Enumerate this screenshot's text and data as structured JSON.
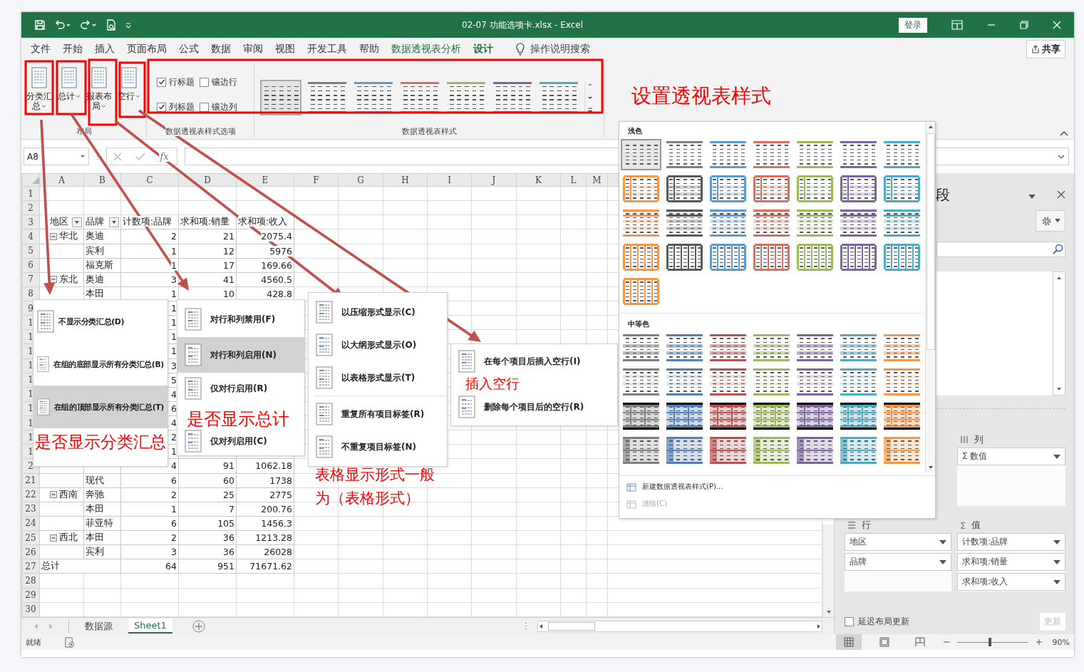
{
  "window": {
    "title": "02-07 功能选项卡.xlsx  -  Excel",
    "sign_in": "登录"
  },
  "ribbon_tabs": [
    {
      "label": "文件",
      "contextual": false,
      "selected": false
    },
    {
      "label": "开始",
      "contextual": false,
      "selected": false
    },
    {
      "label": "插入",
      "contextual": false,
      "selected": false
    },
    {
      "label": "页面布局",
      "contextual": false,
      "selected": false
    },
    {
      "label": "公式",
      "contextual": false,
      "selected": false
    },
    {
      "label": "数据",
      "contextual": false,
      "selected": false
    },
    {
      "label": "审阅",
      "contextual": false,
      "selected": false
    },
    {
      "label": "视图",
      "contextual": false,
      "selected": false
    },
    {
      "label": "开发工具",
      "contextual": false,
      "selected": false
    },
    {
      "label": "帮助",
      "contextual": false,
      "selected": false
    },
    {
      "label": "数据透视表分析",
      "contextual": true,
      "selected": false
    },
    {
      "label": "设计",
      "contextual": true,
      "selected": true
    }
  ],
  "tell_me": "操作说明搜索",
  "share": "共享",
  "ribbon": {
    "layout_group": {
      "label": "布局",
      "buttons": [
        "分类汇总",
        "总计",
        "报表布局",
        "空行"
      ]
    },
    "options_group": {
      "label": "数据透视表样式选项",
      "options": [
        {
          "label": "行标题",
          "checked": true
        },
        {
          "label": "镶边行",
          "checked": false
        },
        {
          "label": "列标题",
          "checked": true
        },
        {
          "label": "镶边列",
          "checked": false
        }
      ]
    },
    "styles_group": {
      "label": "数据透视表样式",
      "styles": [
        {
          "selected": true
        },
        {
          "color": "#7f7f7f",
          "selected": false
        },
        {
          "color": "#5b9bd5",
          "selected": false
        },
        {
          "color": "#e06c5a",
          "selected": false
        },
        {
          "color": "#9bbb59",
          "selected": false
        },
        {
          "color": "#8064a2",
          "selected": false
        },
        {
          "color": "#4bacc6",
          "selected": false
        }
      ]
    }
  },
  "formula_bar": {
    "name_box": "A8",
    "function_label": "fx"
  },
  "sheet": {
    "columns": [
      "A",
      "B",
      "C",
      "D",
      "E",
      "F",
      "G",
      "H",
      "I",
      "J",
      "K",
      "L",
      "M"
    ],
    "rows": [
      {
        "header": "1",
        "kind": "empty"
      },
      {
        "header": "2",
        "kind": "empty"
      },
      {
        "header": "3",
        "kind": "header",
        "region": "地区",
        "brand": "品牌",
        "count": "计数项:品牌",
        "sales": "求和项:销量",
        "revenue": "求和项:收入"
      },
      {
        "header": "4",
        "kind": "item",
        "region": "华北",
        "expanded": true,
        "brand": "奥迪",
        "count": "2",
        "sales": "21",
        "revenue": "2075.4"
      },
      {
        "header": "5",
        "kind": "item",
        "brand": "宾利",
        "count": "1",
        "sales": "12",
        "revenue": "5976"
      },
      {
        "header": "6",
        "kind": "item",
        "brand": "福克斯",
        "count": "1",
        "sales": "17",
        "revenue": "169.66"
      },
      {
        "header": "7",
        "kind": "item",
        "region": "东北",
        "expanded": true,
        "brand": "奥迪",
        "count": "3",
        "sales": "41",
        "revenue": "4560.5"
      },
      {
        "header": "8",
        "kind": "item",
        "brand": "本田",
        "count": "1",
        "sales": "10",
        "revenue": "428.8"
      },
      {
        "header": "9",
        "kind": "item",
        "count": "1"
      },
      {
        "header": "1",
        "kind": "item",
        "count": "1"
      },
      {
        "header": "1",
        "kind": "item",
        "count": "1"
      },
      {
        "header": "1",
        "kind": "item",
        "count": "1"
      },
      {
        "header": "1",
        "kind": "item",
        "count": "3"
      },
      {
        "header": "1",
        "kind": "item",
        "count": "5"
      },
      {
        "header": "1",
        "kind": "item",
        "count": "4"
      },
      {
        "header": "1",
        "kind": "item",
        "count": "6"
      },
      {
        "header": "1",
        "kind": "item",
        "count": "4"
      },
      {
        "header": "1",
        "kind": "item",
        "count": "2"
      },
      {
        "header": "1",
        "kind": "item",
        "count": "1"
      },
      {
        "header": "2",
        "kind": "item",
        "count": "4",
        "sales": "91",
        "revenue": "1062.18"
      },
      {
        "header": "21",
        "kind": "item",
        "brand": "现代",
        "count": "6",
        "sales": "60",
        "revenue": "1738"
      },
      {
        "header": "22",
        "kind": "item",
        "region": "西南",
        "expanded": true,
        "brand": "奔驰",
        "count": "2",
        "sales": "25",
        "revenue": "2775"
      },
      {
        "header": "23",
        "kind": "item",
        "brand": "本田",
        "count": "1",
        "sales": "7",
        "revenue": "200.76"
      },
      {
        "header": "24",
        "kind": "item",
        "brand": "菲亚特",
        "count": "6",
        "sales": "105",
        "revenue": "1456.3"
      },
      {
        "header": "25",
        "kind": "item",
        "region": "西北",
        "expanded": true,
        "brand": "本田",
        "count": "2",
        "sales": "36",
        "revenue": "1213.28"
      },
      {
        "header": "26",
        "kind": "item",
        "brand": "宾利",
        "count": "3",
        "sales": "36",
        "revenue": "26028"
      },
      {
        "header": "27",
        "kind": "total",
        "region": "总计",
        "count": "64",
        "sales": "951",
        "revenue": "71671.62"
      },
      {
        "header": "28",
        "kind": "empty"
      },
      {
        "header": "29",
        "kind": "empty"
      },
      {
        "header": "30",
        "kind": "empty"
      }
    ]
  },
  "sheet_tabs": [
    {
      "label": "数据源",
      "selected": false
    },
    {
      "label": "Sheet1",
      "selected": true
    }
  ],
  "field_list": {
    "title": "段",
    "areas": [
      {
        "kind": "columns",
        "label": "列",
        "fields": [
          "Σ 数值"
        ]
      },
      {
        "kind": "rows",
        "label": "行",
        "fields": [
          "地区",
          "品牌"
        ]
      },
      {
        "kind": "values",
        "label": "值",
        "symbol": "Σ",
        "fields": [
          "计数项:品牌",
          "求和项:销量",
          "求和项:收入"
        ]
      }
    ],
    "defer_update": {
      "label": "延迟布局更新",
      "checked": false
    },
    "update_button": {
      "label": "更新",
      "disabled": true
    }
  },
  "status_bar": {
    "mode": "就绪",
    "views": [
      {
        "kind": "normal",
        "selected": true
      },
      {
        "kind": "page-layout",
        "selected": false
      },
      {
        "kind": "page-break",
        "selected": false
      }
    ],
    "zoom": {
      "level": 0.46,
      "reading": "90%"
    }
  },
  "menus": [
    {
      "kind": "subtotals",
      "items": [
        {
          "label": "不显示分类汇总(D)",
          "selected": false
        },
        {
          "label": "在组的底部显示所有分类汇总(B)",
          "selected": false
        },
        {
          "label": "在组的顶部显示所有分类汇总(T)",
          "selected": true
        }
      ]
    },
    {
      "kind": "grand-totals",
      "items": [
        {
          "label": "对行和列禁用(F)",
          "selected": false
        },
        {
          "label": "对行和列启用(N)",
          "selected": true
        },
        {
          "label": "仅对行启用(R)",
          "selected": false
        },
        {
          "label": "仅对列启用(C)",
          "selected": false
        }
      ]
    },
    {
      "kind": "report-layout",
      "items": [
        {
          "kind": "item",
          "label": "以压缩形式显示(C)",
          "selected": false
        },
        {
          "kind": "item",
          "label": "以大纲形式显示(O)",
          "selected": false
        },
        {
          "kind": "item",
          "label": "以表格形式显示(T)",
          "selected": false
        },
        {
          "kind": "separator"
        },
        {
          "kind": "item",
          "label": "重复所有项目标签(R)",
          "selected": false
        },
        {
          "kind": "item",
          "label": "不重复项目标签(N)",
          "selected": false
        }
      ]
    },
    {
      "kind": "blank-rows",
      "items": [
        {
          "label": "在每个项目后插入空行(I)",
          "selected": false
        },
        {
          "label": "删除每个项目后的空行(R)",
          "selected": false
        }
      ]
    }
  ],
  "style_gallery": {
    "sections": [
      {
        "title": "浅色",
        "styles": [
          {
            "selected": true
          },
          {
            "color": "#7f7f7f",
            "selected": false
          },
          {
            "color": "#5b9bd5",
            "selected": false
          },
          {
            "color": "#e06c5a",
            "selected": false
          },
          {
            "color": "#9bbb59",
            "selected": false
          },
          {
            "color": "#8064a2",
            "selected": false
          },
          {
            "color": "#4bacc6",
            "selected": false
          },
          {
            "color": "#f79646",
            "selected": false
          },
          {
            "color": "#595959",
            "selected": false
          },
          {
            "color": "#5b9bd5",
            "selected": false
          },
          {
            "color": "#e06c5a",
            "selected": false
          },
          {
            "color": "#9bbb59",
            "selected": false
          },
          {
            "color": "#8064a2",
            "selected": false
          },
          {
            "color": "#4bacc6",
            "selected": false
          },
          {
            "color": "#f79646",
            "selected": false
          },
          {
            "color": "#595959",
            "selected": false
          },
          {
            "color": "#5b9bd5",
            "selected": false
          },
          {
            "color": "#e06c5a",
            "selected": false
          },
          {
            "color": "#9bbb59",
            "selected": false
          },
          {
            "color": "#8064a2",
            "selected": false
          },
          {
            "color": "#4bacc6",
            "selected": false
          },
          {
            "color": "#f79646",
            "selected": false
          },
          {
            "color": "#595959",
            "selected": false
          },
          {
            "color": "#5b9bd5",
            "selected": false
          },
          {
            "color": "#e06c5a",
            "selected": false
          },
          {
            "color": "#9bbb59",
            "selected": false
          },
          {
            "color": "#8064a2",
            "selected": false
          },
          {
            "color": "#4bacc6",
            "selected": false
          },
          {
            "color": "#f79646",
            "selected": false
          }
        ]
      },
      {
        "title": "中等色",
        "styles": [
          {
            "color": "#7f7f7f",
            "selected": false
          },
          {
            "color": "#4f81bd",
            "selected": false
          },
          {
            "color": "#c0504d",
            "selected": false
          },
          {
            "color": "#9bbb59",
            "selected": false
          },
          {
            "color": "#8064a2",
            "selected": false
          },
          {
            "color": "#4bacc6",
            "selected": false
          },
          {
            "color": "#f79646",
            "selected": false
          },
          {
            "color": "#7f7f7f",
            "selected": false
          },
          {
            "color": "#4f81bd",
            "selected": false
          },
          {
            "color": "#c0504d",
            "selected": false
          },
          {
            "color": "#9bbb59",
            "selected": false
          },
          {
            "color": "#8064a2",
            "selected": false
          },
          {
            "color": "#4bacc6",
            "selected": false
          },
          {
            "color": "#f79646",
            "selected": false
          },
          {
            "color": "#7f7f7f",
            "selected": false
          },
          {
            "color": "#4f81bd",
            "selected": false
          },
          {
            "color": "#c0504d",
            "selected": false
          },
          {
            "color": "#9bbb59",
            "selected": false
          },
          {
            "color": "#8064a2",
            "selected": false
          },
          {
            "color": "#4bacc6",
            "selected": false
          },
          {
            "color": "#f79646",
            "selected": false
          },
          {
            "color": "#7f7f7f",
            "selected": false
          },
          {
            "color": "#4f81bd",
            "selected": false
          },
          {
            "color": "#c0504d",
            "selected": false
          },
          {
            "color": "#9bbb59",
            "selected": false
          },
          {
            "color": "#8064a2",
            "selected": false
          },
          {
            "color": "#4bacc6",
            "selected": false
          },
          {
            "color": "#f79646",
            "selected": false
          }
        ]
      }
    ],
    "commands": [
      {
        "label": "新建数据透视表样式(P)...",
        "disabled": false
      },
      {
        "label": "清除(C)",
        "disabled": true
      }
    ]
  },
  "annotations": [
    {
      "text": "设置透视表样式"
    },
    {
      "text": "是否显示分类汇总"
    },
    {
      "text": "是否显示总计"
    },
    {
      "text": "表格显示形式一般为（表格形式）"
    },
    {
      "text": "插入空行"
    }
  ]
}
